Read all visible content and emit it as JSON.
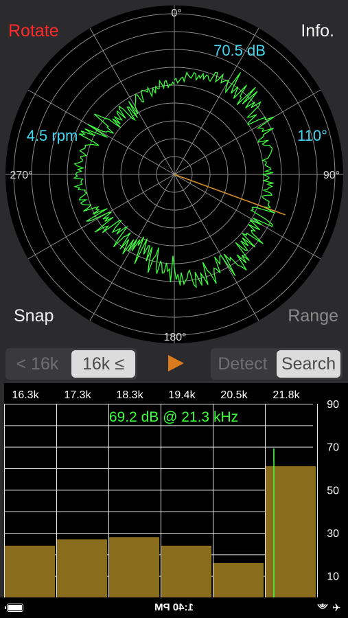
{
  "polar": {
    "angle_labels": {
      "top": "0°",
      "right": "90°",
      "bottom": "180°",
      "left": "270°"
    },
    "level_label": "70.5 dB",
    "rpm_label": "4.5 rpm",
    "angle_readout": "110°",
    "needle_angle_deg": 110,
    "colors": {
      "trace": "#3cff3c",
      "needle": "#d28c28",
      "readout": "#45d8f0",
      "grid": "#8c8c8c"
    }
  },
  "buttons": {
    "rotate": "Rotate",
    "info": "Info.",
    "snap": "Snap",
    "range": "Range"
  },
  "range_toggle": {
    "below": "< 16k",
    "above": "16k ≤",
    "selected": "above"
  },
  "mode_toggle": {
    "detect": "Detect",
    "search": "Search",
    "selected": "search"
  },
  "play_icon": "play-triangle-icon",
  "spectrum": {
    "peak_readout": "69.2 dB @ 21.3 kHz",
    "frequency_labels": [
      "16.3k",
      "17.3k",
      "18.3k",
      "19.4k",
      "20.5k",
      "21.8k"
    ],
    "level_labels": [
      "90",
      "70",
      "50",
      "30",
      "10"
    ],
    "bar_color": "#8a6d1c",
    "marker_color": "#3cff3c"
  },
  "chart_data": {
    "type": "bar",
    "categories": [
      "16.3k",
      "17.3k",
      "18.3k",
      "19.4k",
      "20.5k",
      "21.8k"
    ],
    "values": [
      24,
      27,
      28,
      24,
      16,
      61
    ],
    "ylim": [
      0,
      90
    ],
    "peak_marker": {
      "frequency_khz": 21.3,
      "level_db": 69.2
    },
    "grid": true
  },
  "status_bar": {
    "time": "1:40 PM"
  }
}
